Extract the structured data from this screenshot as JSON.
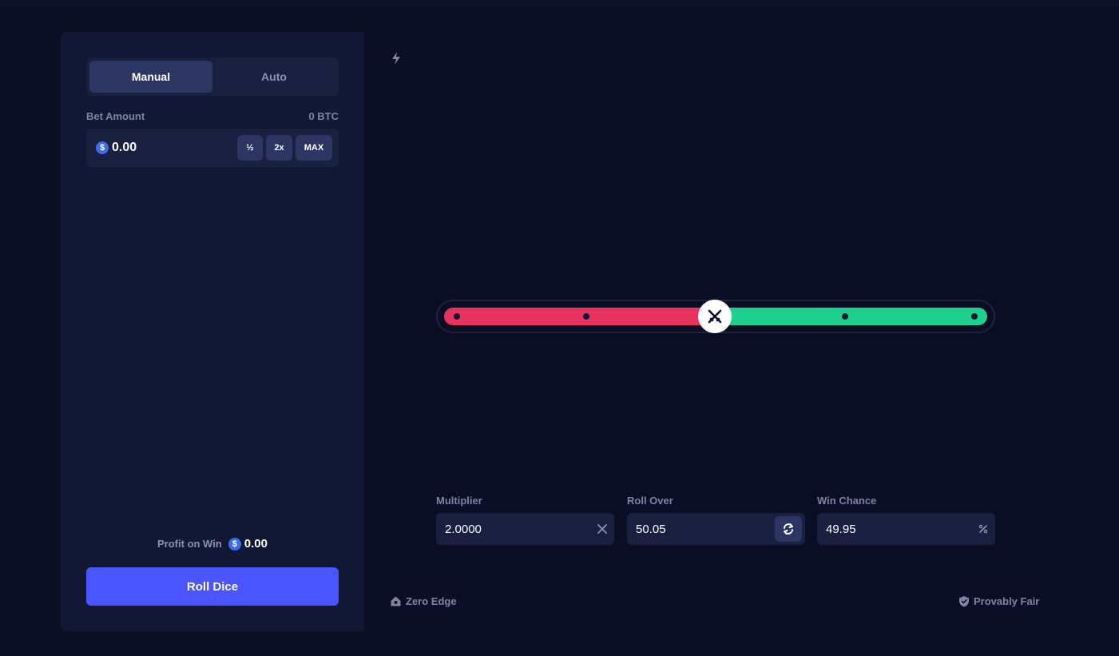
{
  "mode_tabs": [
    {
      "label": "Manual",
      "active": true
    },
    {
      "label": "Auto",
      "active": false
    }
  ],
  "bet": {
    "label": "Bet Amount",
    "balance": "0 BTC",
    "currency_icon": "$",
    "value": "0.00",
    "half_label": "½",
    "double_label": "2x",
    "max_label": "MAX"
  },
  "profit": {
    "label": "Profit on Win",
    "currency_icon": "$",
    "value": "0.00"
  },
  "roll_button": "Roll Dice",
  "slider": {
    "value": 50.05,
    "range": [
      0,
      100
    ],
    "colors": {
      "lose": "#e8325e",
      "win": "#1ed08e"
    }
  },
  "fields": {
    "multiplier": {
      "label": "Multiplier",
      "value": "2.0000",
      "icon": "x-icon"
    },
    "roll_over": {
      "label": "Roll Over",
      "value": "50.05",
      "icon": "swap-icon"
    },
    "win_chance": {
      "label": "Win Chance",
      "value": "49.95",
      "icon": "percent-icon"
    }
  },
  "footer": {
    "zero_edge": "Zero Edge",
    "provably_fair": "Provably Fair"
  },
  "colors": {
    "accent": "#4a55ff",
    "background": "#0b0f23",
    "panel": "#121833",
    "input": "#1a2140"
  }
}
